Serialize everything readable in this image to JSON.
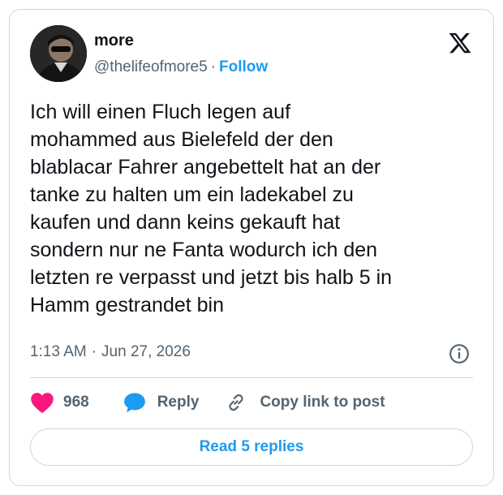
{
  "author": {
    "name": "more",
    "handle": "@thelifeofmore5",
    "separator": "·",
    "follow_label": "Follow"
  },
  "tweet": {
    "text": "Ich will einen Fluch legen auf\nmohammed aus Bielefeld der den\nblablacar Fahrer angebettelt hat an der\ntanke zu halten um ein ladekabel zu\nkaufen und dann keins gekauft hat\nsondern nur ne Fanta wodurch ich den\nletzten re verpasst und jetzt bis halb 5 in\nHamm gestrandet bin",
    "time": "1:13 AM",
    "separator": "·",
    "date": "Jun 27, 2026"
  },
  "actions": {
    "like_count": "968",
    "reply_label": "Reply",
    "copy_label": "Copy link to post"
  },
  "read_replies_label": "Read 5 replies",
  "icons": {
    "logo": "x-logo-icon",
    "info": "info-icon",
    "like": "heart-icon",
    "reply": "speech-bubble-icon",
    "copy": "link-icon"
  },
  "colors": {
    "accent": "#1d9bf0",
    "like": "#f91880",
    "text": "#0f1419",
    "muted": "#536471",
    "border": "#cfd9de"
  }
}
